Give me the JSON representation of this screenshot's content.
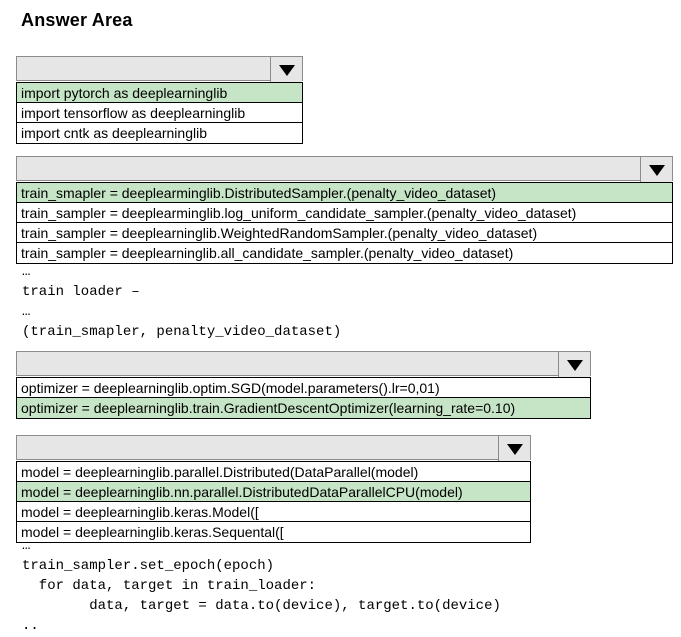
{
  "title": "Answer Area",
  "colors": {
    "selected": "#c6e4c6",
    "bar": "#e6e6e6"
  },
  "icon": "dropdown-arrow-icon",
  "dropdowns": [
    {
      "options": [
        {
          "text": "import pytorch as deeplearninglib",
          "selected": true
        },
        {
          "text": "import tensorflow as deeplearninglib",
          "selected": false
        },
        {
          "text": "import cntk as deeplearninglib",
          "selected": false
        }
      ]
    },
    {
      "options": [
        {
          "text": "train_smapler = deeplearminglib.DistributedSampler.(penalty_video_dataset)",
          "selected": true
        },
        {
          "text": "train_sampler = deeplearminglib.log_uniform_candidate_sampler.(penalty_video_dataset)",
          "selected": false
        },
        {
          "text": "train_sampler = deeplearninglib.WeightedRandomSampler.(penalty_video_dataset)",
          "selected": false
        },
        {
          "text": "train_sampler = deeplearninglib.all_candidate_sampler.(penalty_video_dataset)",
          "selected": false
        }
      ]
    },
    {
      "options": [
        {
          "text": "optimizer = deeplearninglib.optim.SGD(model.parameters().lr=0,01)",
          "selected": false
        },
        {
          "text": "optimizer = deeplearninglib.train.GradientDescentOptimizer(learning_rate=0.10)",
          "selected": true
        }
      ]
    },
    {
      "options": [
        {
          "text": "model = deeplearninglib.parallel.Distributed(DataParallel(model)",
          "selected": false
        },
        {
          "text": "model = deeplearninglib.nn.parallel.DistributedDataParallelCPU(model)",
          "selected": true
        },
        {
          "text": "model = deeplearninglib.keras.Model([",
          "selected": false
        },
        {
          "text": "model = deeplearninglib.keras.Sequental([",
          "selected": false
        }
      ]
    }
  ],
  "code1": [
    "…",
    "train loader –",
    "…",
    "(train_smapler, penalty_video_dataset)"
  ],
  "code2": [
    "…",
    "train_sampler.set_epoch(epoch)",
    "  for data, target in train_loader:",
    "        data, target = data.to(device), target.to(device)",
    ".."
  ]
}
